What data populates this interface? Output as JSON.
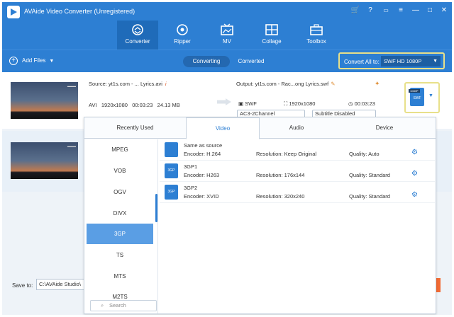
{
  "app": {
    "title": "AVAide Video Converter (Unregistered)"
  },
  "nav": {
    "tabs": [
      {
        "label": "Converter",
        "icon": "convert-icon"
      },
      {
        "label": "Ripper",
        "icon": "disc-icon"
      },
      {
        "label": "MV",
        "icon": "tv-icon"
      },
      {
        "label": "Collage",
        "icon": "collage-icon"
      },
      {
        "label": "Toolbox",
        "icon": "toolbox-icon"
      }
    ]
  },
  "actionbar": {
    "add_files": "Add Files",
    "seg": [
      "Converting",
      "Converted"
    ],
    "convert_all_label": "Convert All to:",
    "convert_all_value": "SWF HD 1080P"
  },
  "file1": {
    "source": "Source: yt1s.com - ... Lyrics.avi",
    "fmt": "AVI",
    "res": "1920x1080",
    "dur": "00:03:23",
    "size": "24.13 MB",
    "output": "Output: yt1s.com - Rac...ong Lyrics.swf",
    "out_fmt": "SWF",
    "out_res": "1920x1080",
    "out_dur": "00:03:23",
    "audio": "AC3-2Channel",
    "subtitle": "Subtitle Disabled",
    "fmt_badge": "1080P",
    "fmt_ext": "SWF"
  },
  "panel": {
    "tabs": [
      "Recently Used",
      "Video",
      "Audio",
      "Device"
    ],
    "categories": [
      "MPEG",
      "VOB",
      "OGV",
      "DIVX",
      "3GP",
      "TS",
      "MTS",
      "M2TS"
    ],
    "search_placeholder": "Search",
    "options": [
      {
        "name": "Same as source",
        "icon": "",
        "encoder": "Encoder: H.264",
        "resolution": "Resolution: Keep Original",
        "quality": "Quality: Auto"
      },
      {
        "name": "3GP1",
        "icon": "3GP",
        "encoder": "Encoder: H263",
        "resolution": "Resolution: 176x144",
        "quality": "Quality: Standard"
      },
      {
        "name": "3GP2",
        "icon": "3GP",
        "encoder": "Encoder: XVID",
        "resolution": "Resolution: 320x240",
        "quality": "Quality: Standard"
      }
    ]
  },
  "bottom": {
    "save_to": "Save to:",
    "path": "C:\\AVAide Studio\\"
  },
  "colors": {
    "brand": "#2d7fd3",
    "accent": "#e0913a",
    "active_tab": "#1f6bb9"
  }
}
